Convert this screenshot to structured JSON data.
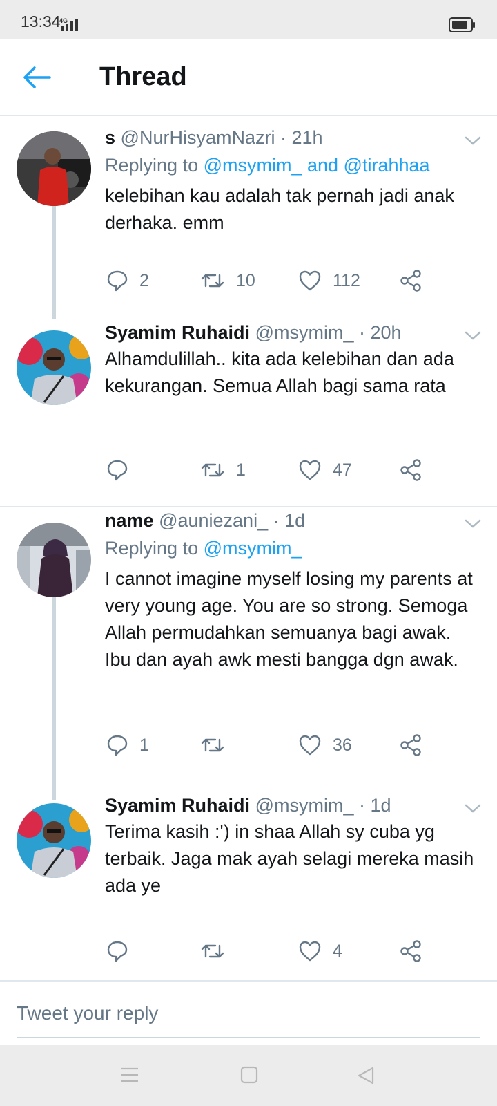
{
  "status_bar": {
    "time": "13:34",
    "network": "4G"
  },
  "header": {
    "title": "Thread"
  },
  "tweets": [
    {
      "name": "s",
      "handle": "@NurHisyamNazri",
      "time": "21h",
      "replying_prefix": "Replying to",
      "replying_to": "@msymim_ and @tirahhaa",
      "text": "kelebihan kau adalah tak pernah jadi anak derhaka. emm",
      "replies": "2",
      "retweets": "10",
      "likes": "112"
    },
    {
      "name": "Syamim Ruhaidi",
      "handle": "@msymim_",
      "time": "20h",
      "text": "Alhamdulillah.. kita ada kelebihan dan ada kekurangan. Semua Allah bagi sama rata",
      "replies": "",
      "retweets": "1",
      "likes": "47"
    },
    {
      "name": "name",
      "handle": "@auniezani_",
      "time": "1d",
      "replying_prefix": "Replying to",
      "replying_to": "@msymim_",
      "text": "I cannot imagine myself losing my parents at very young age. You are so strong. Semoga Allah permudahkan semuanya bagi awak. Ibu dan ayah awk mesti bangga dgn awak.",
      "replies": "1",
      "retweets": "",
      "likes": "36"
    },
    {
      "name": "Syamim Ruhaidi",
      "handle": "@msymim_",
      "time": "1d",
      "text": "Terima kasih :') in shaa Allah sy cuba yg terbaik. Jaga mak ayah selagi mereka masih ada ye",
      "replies": "",
      "retweets": "",
      "likes": "4"
    }
  ],
  "reply_box": {
    "placeholder": "Tweet your reply"
  },
  "colors": {
    "accent": "#1da1f2",
    "muted": "#657786",
    "text": "#14171a",
    "divider": "#e1e8ed"
  },
  "icons": [
    "back-arrow-icon",
    "reply-icon",
    "retweet-icon",
    "like-icon",
    "share-icon",
    "chevron-down-icon",
    "menu-nav-icon",
    "home-nav-icon",
    "back-nav-icon"
  ]
}
